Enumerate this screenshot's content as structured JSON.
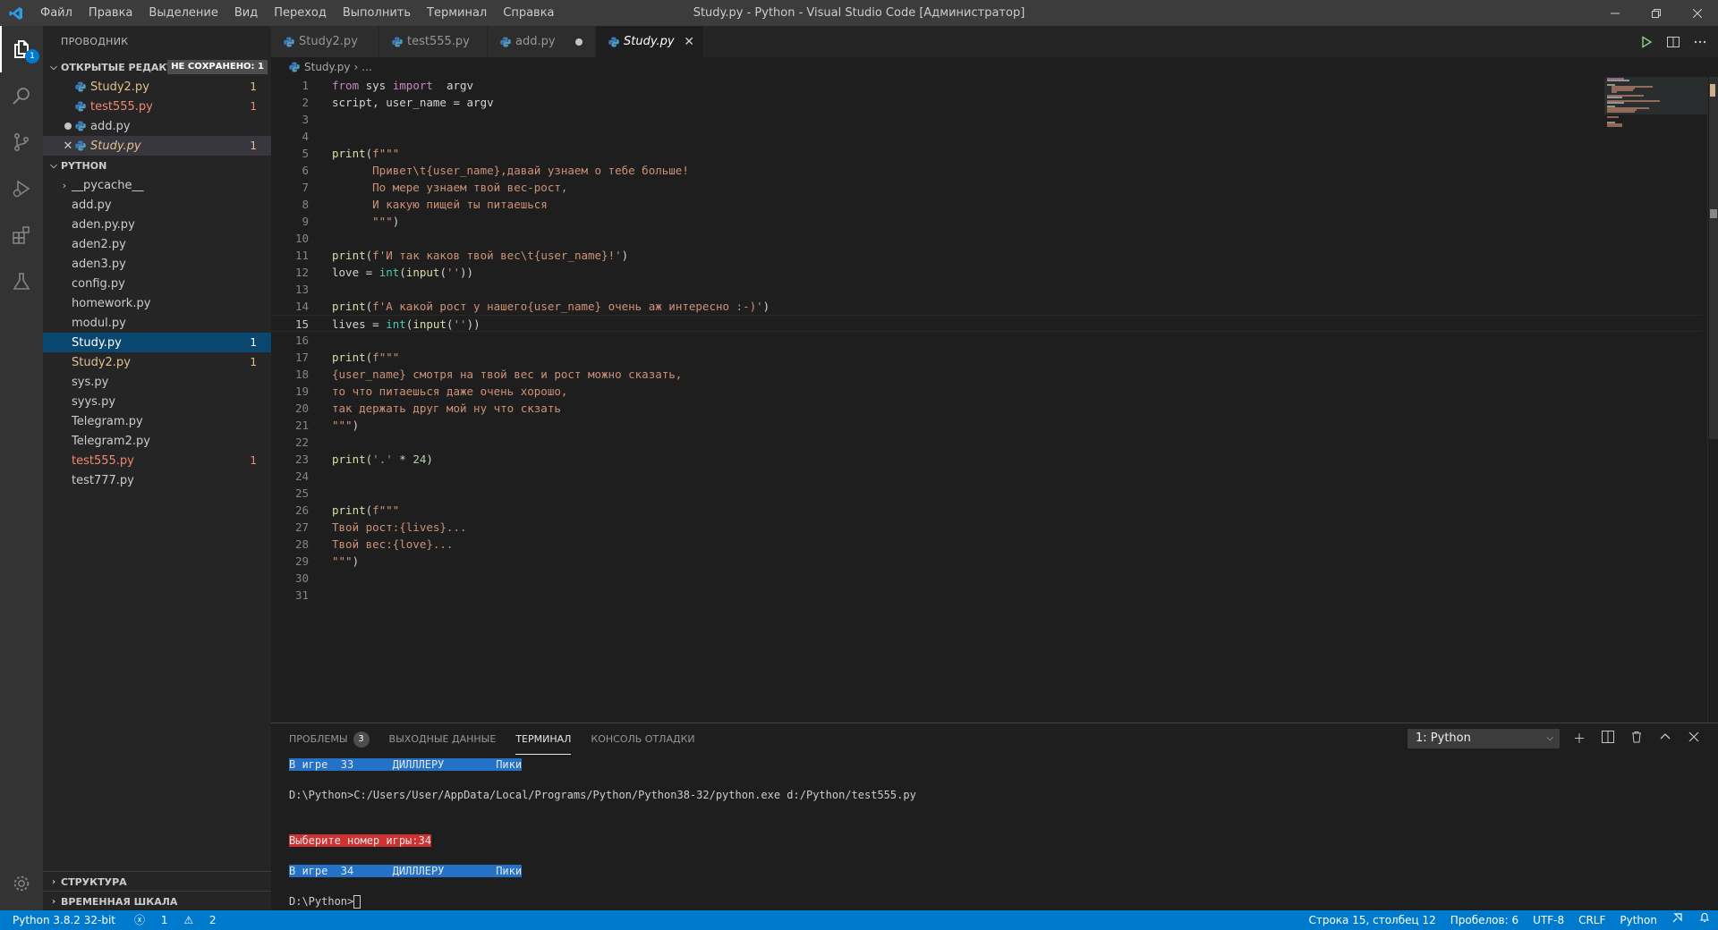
{
  "titlebar": {
    "menu": [
      "Файл",
      "Правка",
      "Выделение",
      "Вид",
      "Переход",
      "Выполнить",
      "Терминал",
      "Справка"
    ],
    "title": "Study.py - Python - Visual Studio Code [Администратор]"
  },
  "activity": {
    "explorer_badge": "1"
  },
  "sidebar": {
    "title": "ПРОВОДНИК",
    "open_editors": {
      "label": "ОТКРЫТЫЕ РЕДАКТО...",
      "unsaved_badge": "НЕ СОХРАНЕНО: 1",
      "items": [
        {
          "name": "Study2.py",
          "count": "1"
        },
        {
          "name": "test555.py",
          "count": "1"
        },
        {
          "name": "add.py",
          "count": ""
        },
        {
          "name": "Study.py",
          "count": "1"
        }
      ]
    },
    "folder": {
      "label": "PYTHON",
      "items": [
        {
          "name": "__pycache__",
          "count": ""
        },
        {
          "name": "add.py",
          "count": ""
        },
        {
          "name": "aden.py.py",
          "count": ""
        },
        {
          "name": "aden2.py",
          "count": ""
        },
        {
          "name": "aden3.py",
          "count": ""
        },
        {
          "name": "config.py",
          "count": ""
        },
        {
          "name": "homework.py",
          "count": ""
        },
        {
          "name": "modul.py",
          "count": ""
        },
        {
          "name": "Study.py",
          "count": "1"
        },
        {
          "name": "Study2.py",
          "count": "1"
        },
        {
          "name": "sys.py",
          "count": ""
        },
        {
          "name": "syys.py",
          "count": ""
        },
        {
          "name": "Telegram.py",
          "count": ""
        },
        {
          "name": "Telegram2.py",
          "count": ""
        },
        {
          "name": "test555.py",
          "count": "1"
        },
        {
          "name": "test777.py",
          "count": ""
        }
      ]
    },
    "outline_label": "СТРУКТУРА",
    "timeline_label": "ВРЕМЕННАЯ ШКАЛА"
  },
  "tabs": [
    "Study2.py",
    "test555.py",
    "add.py",
    "Study.py"
  ],
  "breadcrumb": {
    "file": "Study.py",
    "rest": "..."
  },
  "editor": {
    "line_numbers": [
      "1",
      "2",
      "3",
      "4",
      "5",
      "6",
      "7",
      "8",
      "9",
      "10",
      "11",
      "12",
      "13",
      "14",
      "15",
      "16",
      "17",
      "18",
      "19",
      "20",
      "21",
      "22",
      "23",
      "24",
      "25",
      "26",
      "27",
      "28",
      "29",
      "30",
      "31"
    ],
    "code": {
      "l1a": "from",
      "l1b": " sys ",
      "l1c": "import",
      "l1d": "  argv",
      "l2": "script, user_name = argv",
      "l5a": "print",
      "l5b": "(",
      "l5c": "f\"\"\"",
      "l6": "      Привет\\t{user_name},давай узнаем о тебе больше!",
      "l7": "      По мере узнаем твой вес-рост,",
      "l8": "      И какую пищей ты питаешься",
      "l9a": "      \"\"\"",
      "l9b": ")",
      "l11a": "print",
      "l11b": "(",
      "l11c": "f'И так каков твой вес\\t{user_name}!'",
      "l11d": ")",
      "l12a": "love = ",
      "l12b": "int",
      "l12c": "(",
      "l12d": "input",
      "l12e": "(",
      "l12f": "''",
      "l12g": "))",
      "l14a": "print",
      "l14b": "(",
      "l14c": "f'А какой рост у нашего{user_name} очень аж интересно :-)'",
      "l14d": ")",
      "l15a": "lives = ",
      "l15b": "int",
      "l15c": "(",
      "l15d": "input",
      "l15e": "(",
      "l15f": "''",
      "l15g": "))",
      "l17a": "print",
      "l17b": "(",
      "l17c": "f\"\"\"",
      "l18": "{user_name} смотря на твой вес и рост можно сказать,",
      "l19": "то что питаешься даже очень хорошо,",
      "l20": "так держать друг мой ну что скзать",
      "l21a": "\"\"\"",
      "l21b": ")",
      "l23a": "print",
      "l23b": "(",
      "l23c": "'.'",
      "l23d": " * ",
      "l23e": "24",
      "l23f": ")",
      "l26a": "print",
      "l26b": "(",
      "l26c": "f\"\"\"",
      "l27": "Твой рост:{lives}...",
      "l28": "Твой вес:{love}...",
      "l29a": "\"\"\"",
      "l29b": ")"
    }
  },
  "panel": {
    "tabs": {
      "problems": "ПРОБЛЕМЫ",
      "problems_count": "3",
      "output": "ВЫХОДНЫЕ ДАННЫЕ",
      "terminal": "ТЕРМИНАЛ",
      "debug": "КОНСОЛЬ ОТЛАДКИ"
    },
    "terminal_select": "1: Python",
    "lines": {
      "t1": "В игре  33      ДИЛЛЛЕРУ        Пики",
      "t2": "D:\\Python>C:/Users/User/AppData/Local/Programs/Python/Python38-32/python.exe d:/Python/test555.py",
      "t3": "Выберите номер игры:34",
      "t4": "В игре  34      ДИЛЛЛЕРУ        Пики",
      "t5": "D:\\Python>"
    }
  },
  "status": {
    "interpreter": "Python 3.8.2 32-bit",
    "errors": "1",
    "warnings": "2",
    "position": "Строка 15, столбец 12",
    "spaces": "Пробелов: 6",
    "encoding": "UTF-8",
    "eol": "CRLF",
    "language": "Python"
  },
  "colors": {
    "accent": "#007acc",
    "modified": "#e2c08d",
    "error": "#f48771",
    "selection": "#094771"
  }
}
